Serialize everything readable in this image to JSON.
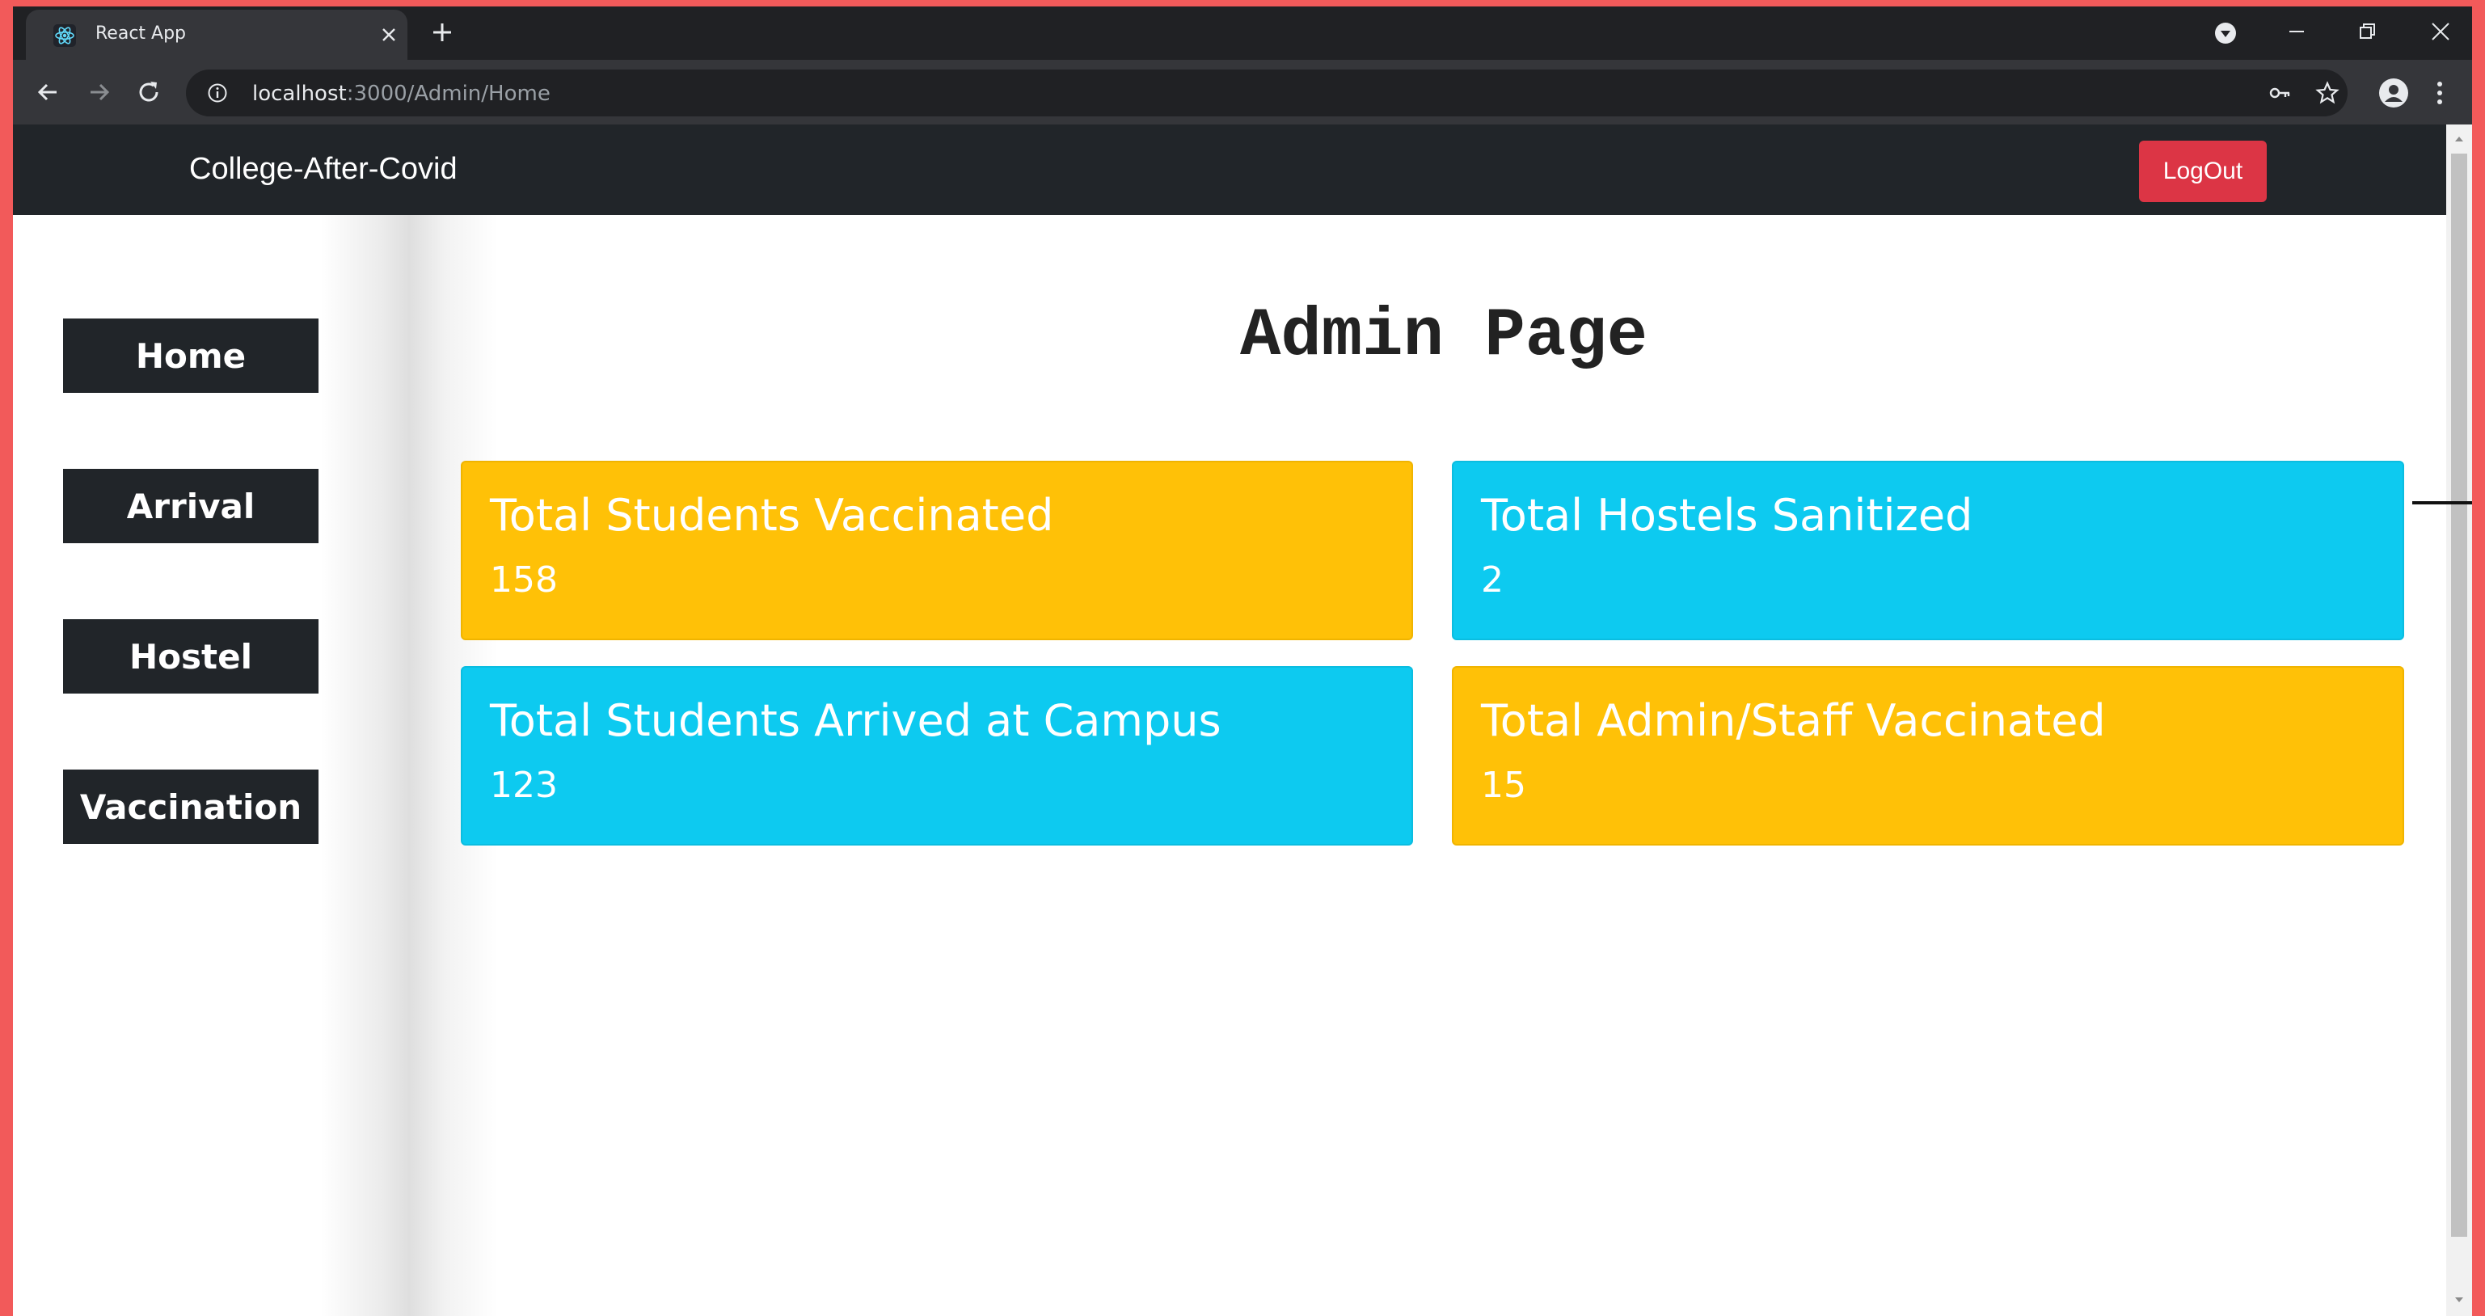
{
  "browser": {
    "tab_title": "React App",
    "url_host": "localhost",
    "url_path": ":3000/Admin/Home"
  },
  "navbar": {
    "brand": "College-After-Covid",
    "logout_label": "LogOut"
  },
  "sidebar": {
    "items": [
      {
        "label": "Home"
      },
      {
        "label": "Arrival"
      },
      {
        "label": "Hostel"
      },
      {
        "label": "Vaccination"
      }
    ]
  },
  "main": {
    "title": "Admin Page",
    "cards": [
      {
        "title": "Total Students Vaccinated",
        "value": "158",
        "color": "#ffc107"
      },
      {
        "title": "Total Hostels Sanitized",
        "value": "2",
        "color": "#0dcaf0"
      },
      {
        "title": "Total Students Arrived at Campus",
        "value": "123",
        "color": "#0dcaf0"
      },
      {
        "title": "Total Admin/Staff Vaccinated",
        "value": "15",
        "color": "#ffc107"
      }
    ]
  },
  "colors": {
    "navbar_bg": "#212529",
    "logout_bg": "#dc3545",
    "page_border": "#f25a5a"
  }
}
